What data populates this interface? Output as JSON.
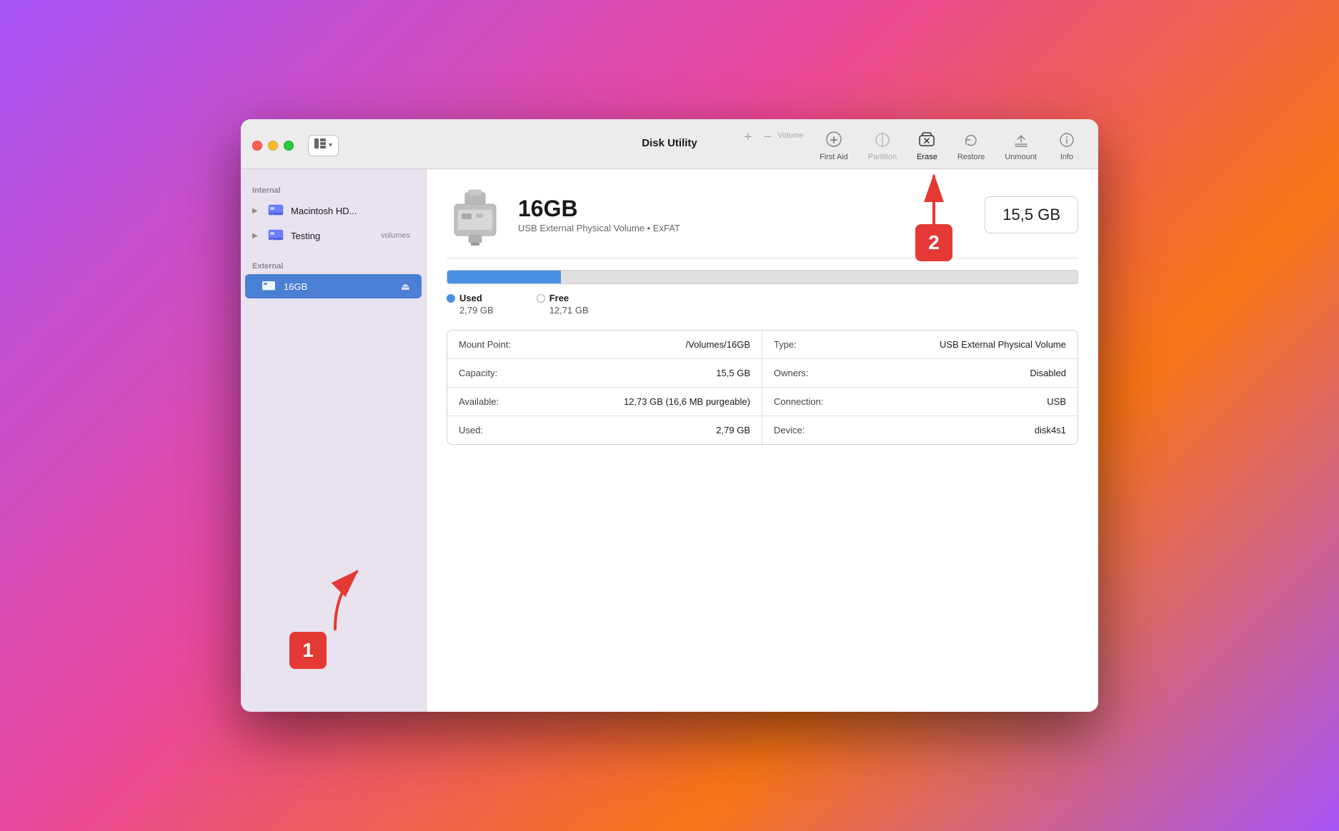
{
  "window": {
    "title": "Disk Utility"
  },
  "toolbar": {
    "view_label": "View",
    "volume_label": "Volume",
    "firstaid_label": "First Aid",
    "partition_label": "Partition",
    "erase_label": "Erase",
    "restore_label": "Restore",
    "unmount_label": "Unmount",
    "info_label": "Info"
  },
  "sidebar": {
    "internal_label": "Internal",
    "external_label": "External",
    "items": [
      {
        "id": "macintosh-hd",
        "label": "Macintosh HD...",
        "badge": "",
        "active": false
      },
      {
        "id": "testing",
        "label": "Testing",
        "badge": "volumes",
        "active": false
      },
      {
        "id": "16gb",
        "label": "16GB",
        "badge": "",
        "active": true
      }
    ]
  },
  "detail": {
    "disk_name": "16GB",
    "disk_subtitle": "USB External Physical Volume • ExFAT",
    "disk_size_badge": "15,5 GB",
    "used_label": "Used",
    "used_value": "2,79 GB",
    "free_label": "Free",
    "free_value": "12,71 GB",
    "used_percent": 18,
    "info_rows": [
      {
        "left_key": "Mount Point:",
        "left_value": "/Volumes/16GB",
        "right_key": "Type:",
        "right_value": "USB External Physical Volume"
      },
      {
        "left_key": "Capacity:",
        "left_value": "15,5 GB",
        "right_key": "Owners:",
        "right_value": "Disabled"
      },
      {
        "left_key": "Available:",
        "left_value": "12,73 GB (16,6 MB purgeable)",
        "right_key": "Connection:",
        "right_value": "USB"
      },
      {
        "left_key": "Used:",
        "left_value": "2,79 GB",
        "right_key": "Device:",
        "right_value": "disk4s1"
      }
    ]
  },
  "annotations": {
    "badge1": "1",
    "badge2": "2"
  }
}
